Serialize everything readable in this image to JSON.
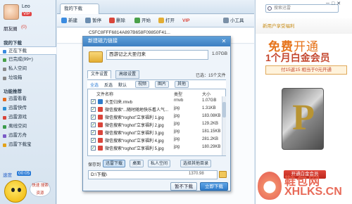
{
  "sidebar": {
    "username": "Leo",
    "level_badge": "VIP",
    "friends_label": "朋友圈",
    "friends_count": "(0)",
    "my_downloads_title": "我的下载",
    "items": [
      {
        "label": "正在下载",
        "color": "#3a8be0"
      },
      {
        "label": "已完成(99+)",
        "color": "#4aa04a"
      },
      {
        "label": "私人空间",
        "color": "#888888"
      },
      {
        "label": "垃圾箱",
        "color": "#888888"
      }
    ],
    "features_title": "功能推荐",
    "features": [
      {
        "label": "迅雷看看",
        "color": "#e56b1f"
      },
      {
        "label": "迅雷快传",
        "color": "#2c8fd4"
      },
      {
        "label": "迅雷游戏",
        "color": "#d9453a"
      },
      {
        "label": "离线空间",
        "color": "#3b9b4c"
      },
      {
        "label": "迅雷方舟",
        "color": "#7a5bc7"
      },
      {
        "label": "迅雷下载宝",
        "color": "#e3a21a"
      }
    ],
    "speed_label": "速度",
    "speed_value": "00:05",
    "mascot_bubble": "快速 搜索资源"
  },
  "main": {
    "tab_label": "我的下载",
    "toolbar": [
      "新建",
      "暂停",
      "删除",
      "开始",
      "打开",
      "VIP",
      "小工具"
    ],
    "task_name": "C5FC8FFF6814A897B658F09850F41...",
    "task_progress": 0.6
  },
  "dialog": {
    "title": "新建磁力链接",
    "torrent_name": "西游记之大圣归来",
    "torrent_size": "1.07GB",
    "tabs": [
      "文件设置",
      "高级设置"
    ],
    "selected_info": "已选：15个文件",
    "filters": [
      "全选",
      "反选",
      "默认"
    ],
    "filter_buttons": [
      "视频",
      "图片",
      "其他"
    ],
    "columns": [
      "文件名称",
      "类型",
      "大小"
    ],
    "files": [
      {
        "name": "大圣归来.rmvb",
        "type": "rmvb",
        "size": "1.07GB",
        "color": "#2f7bc9"
      },
      {
        "name": "微信搜索“...随时随地快乐看人气...",
        "type": "jpg",
        "size": "1.31KB",
        "color": "#d9453a"
      },
      {
        "name": "微信搜索“roghot”立享福利 1.jpg",
        "type": "jpg",
        "size": "183.08KB",
        "color": "#d9453a"
      },
      {
        "name": "微信搜索“roghot”立享福利 2.jpg",
        "type": "jpg",
        "size": "129.2KB",
        "color": "#d9453a"
      },
      {
        "name": "微信搜索“roghot”立享福利 3.jpg",
        "type": "jpg",
        "size": "181.15KB",
        "color": "#d9453a"
      },
      {
        "name": "微信搜索“roghot”立享福利 4.jpg",
        "type": "jpg",
        "size": "281.2KB",
        "color": "#d9453a"
      },
      {
        "name": "微信搜索“roghot”立享福利 5.jpg",
        "type": "jpg",
        "size": "180.29KB",
        "color": "#d9453a"
      }
    ],
    "save_label": "保存到",
    "save_buttons": [
      "迅雷下载",
      "桌面",
      "私人空间",
      "选择其他目录"
    ],
    "path": "D:\\下载\\",
    "free_space": "1370.98",
    "btn_later": "暂不下载",
    "btn_now": "立即下载"
  },
  "right": {
    "search_placeholder": "搜索迅雷",
    "ad_top": "新用户享受福利",
    "ad_headline_bold": "免费",
    "ad_headline_thin": "开通",
    "ad_subline": "1个月白金会员",
    "ad_promo": "付15返15 相当于0元开通",
    "ad_logo_letter": "P",
    "ad_bottom": "开通白金会员"
  },
  "watermark": {
    "cn": "鞋包网",
    "en": "XHLKS.CN"
  }
}
